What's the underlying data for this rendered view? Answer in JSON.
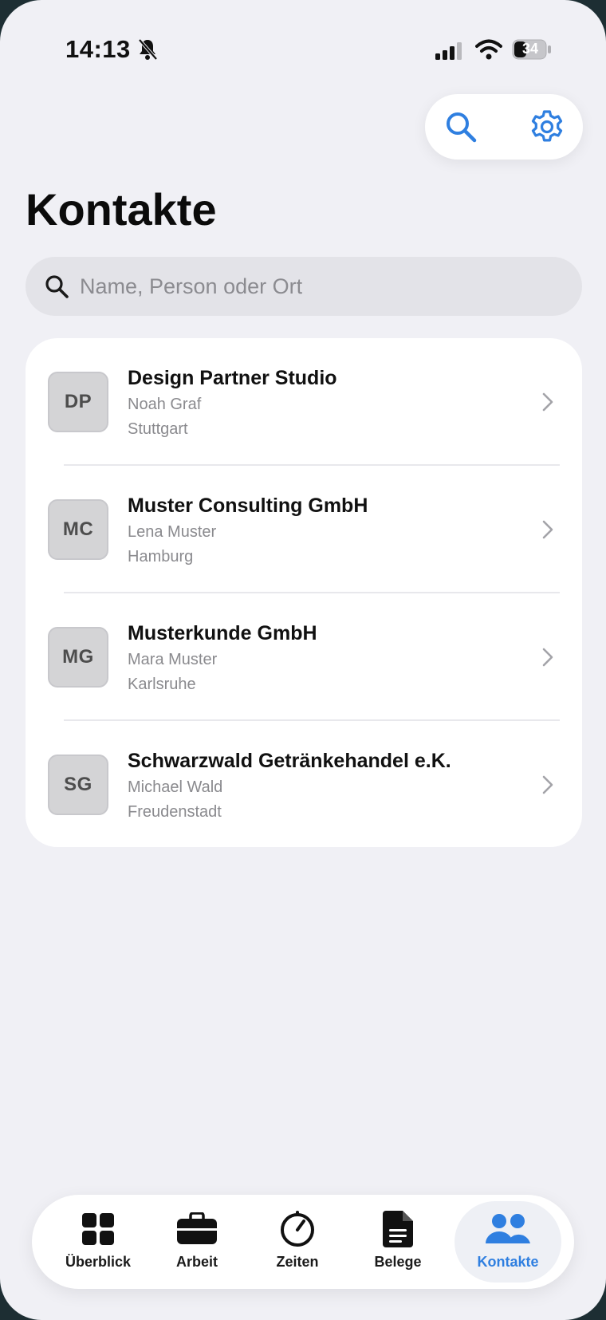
{
  "colors": {
    "accent": "#2f7fe0",
    "background": "#f0f0f5",
    "card": "#ffffff",
    "avatar": "#d4d4d6",
    "secondary_text": "#8a8a8e"
  },
  "status_bar": {
    "time": "14:13",
    "battery": "34",
    "icons": [
      "bell-slash-icon",
      "signal-icon",
      "wifi-icon",
      "battery-icon"
    ]
  },
  "toolbar": {
    "icons": [
      "search-icon",
      "gear-icon"
    ]
  },
  "page": {
    "title": "Kontakte"
  },
  "search": {
    "placeholder": "Name, Person oder Ort",
    "value": ""
  },
  "contacts": [
    {
      "initials": "DP",
      "name": "Design Partner Studio",
      "person": "Noah Graf",
      "city": "Stuttgart"
    },
    {
      "initials": "MC",
      "name": "Muster Consulting GmbH",
      "person": "Lena Muster",
      "city": "Hamburg"
    },
    {
      "initials": "MG",
      "name": "Musterkunde GmbH",
      "person": "Mara Muster",
      "city": "Karlsruhe"
    },
    {
      "initials": "SG",
      "name": "Schwarzwald Getränkehandel e.K.",
      "person": "Michael Wald",
      "city": "Freudenstadt"
    }
  ],
  "tabs": [
    {
      "label": "Überblick",
      "icon": "grid-icon",
      "active": false
    },
    {
      "label": "Arbeit",
      "icon": "briefcase-icon",
      "active": false
    },
    {
      "label": "Zeiten",
      "icon": "timer-icon",
      "active": false
    },
    {
      "label": "Belege",
      "icon": "document-icon",
      "active": false
    },
    {
      "label": "Kontakte",
      "icon": "people-icon",
      "active": true
    }
  ]
}
